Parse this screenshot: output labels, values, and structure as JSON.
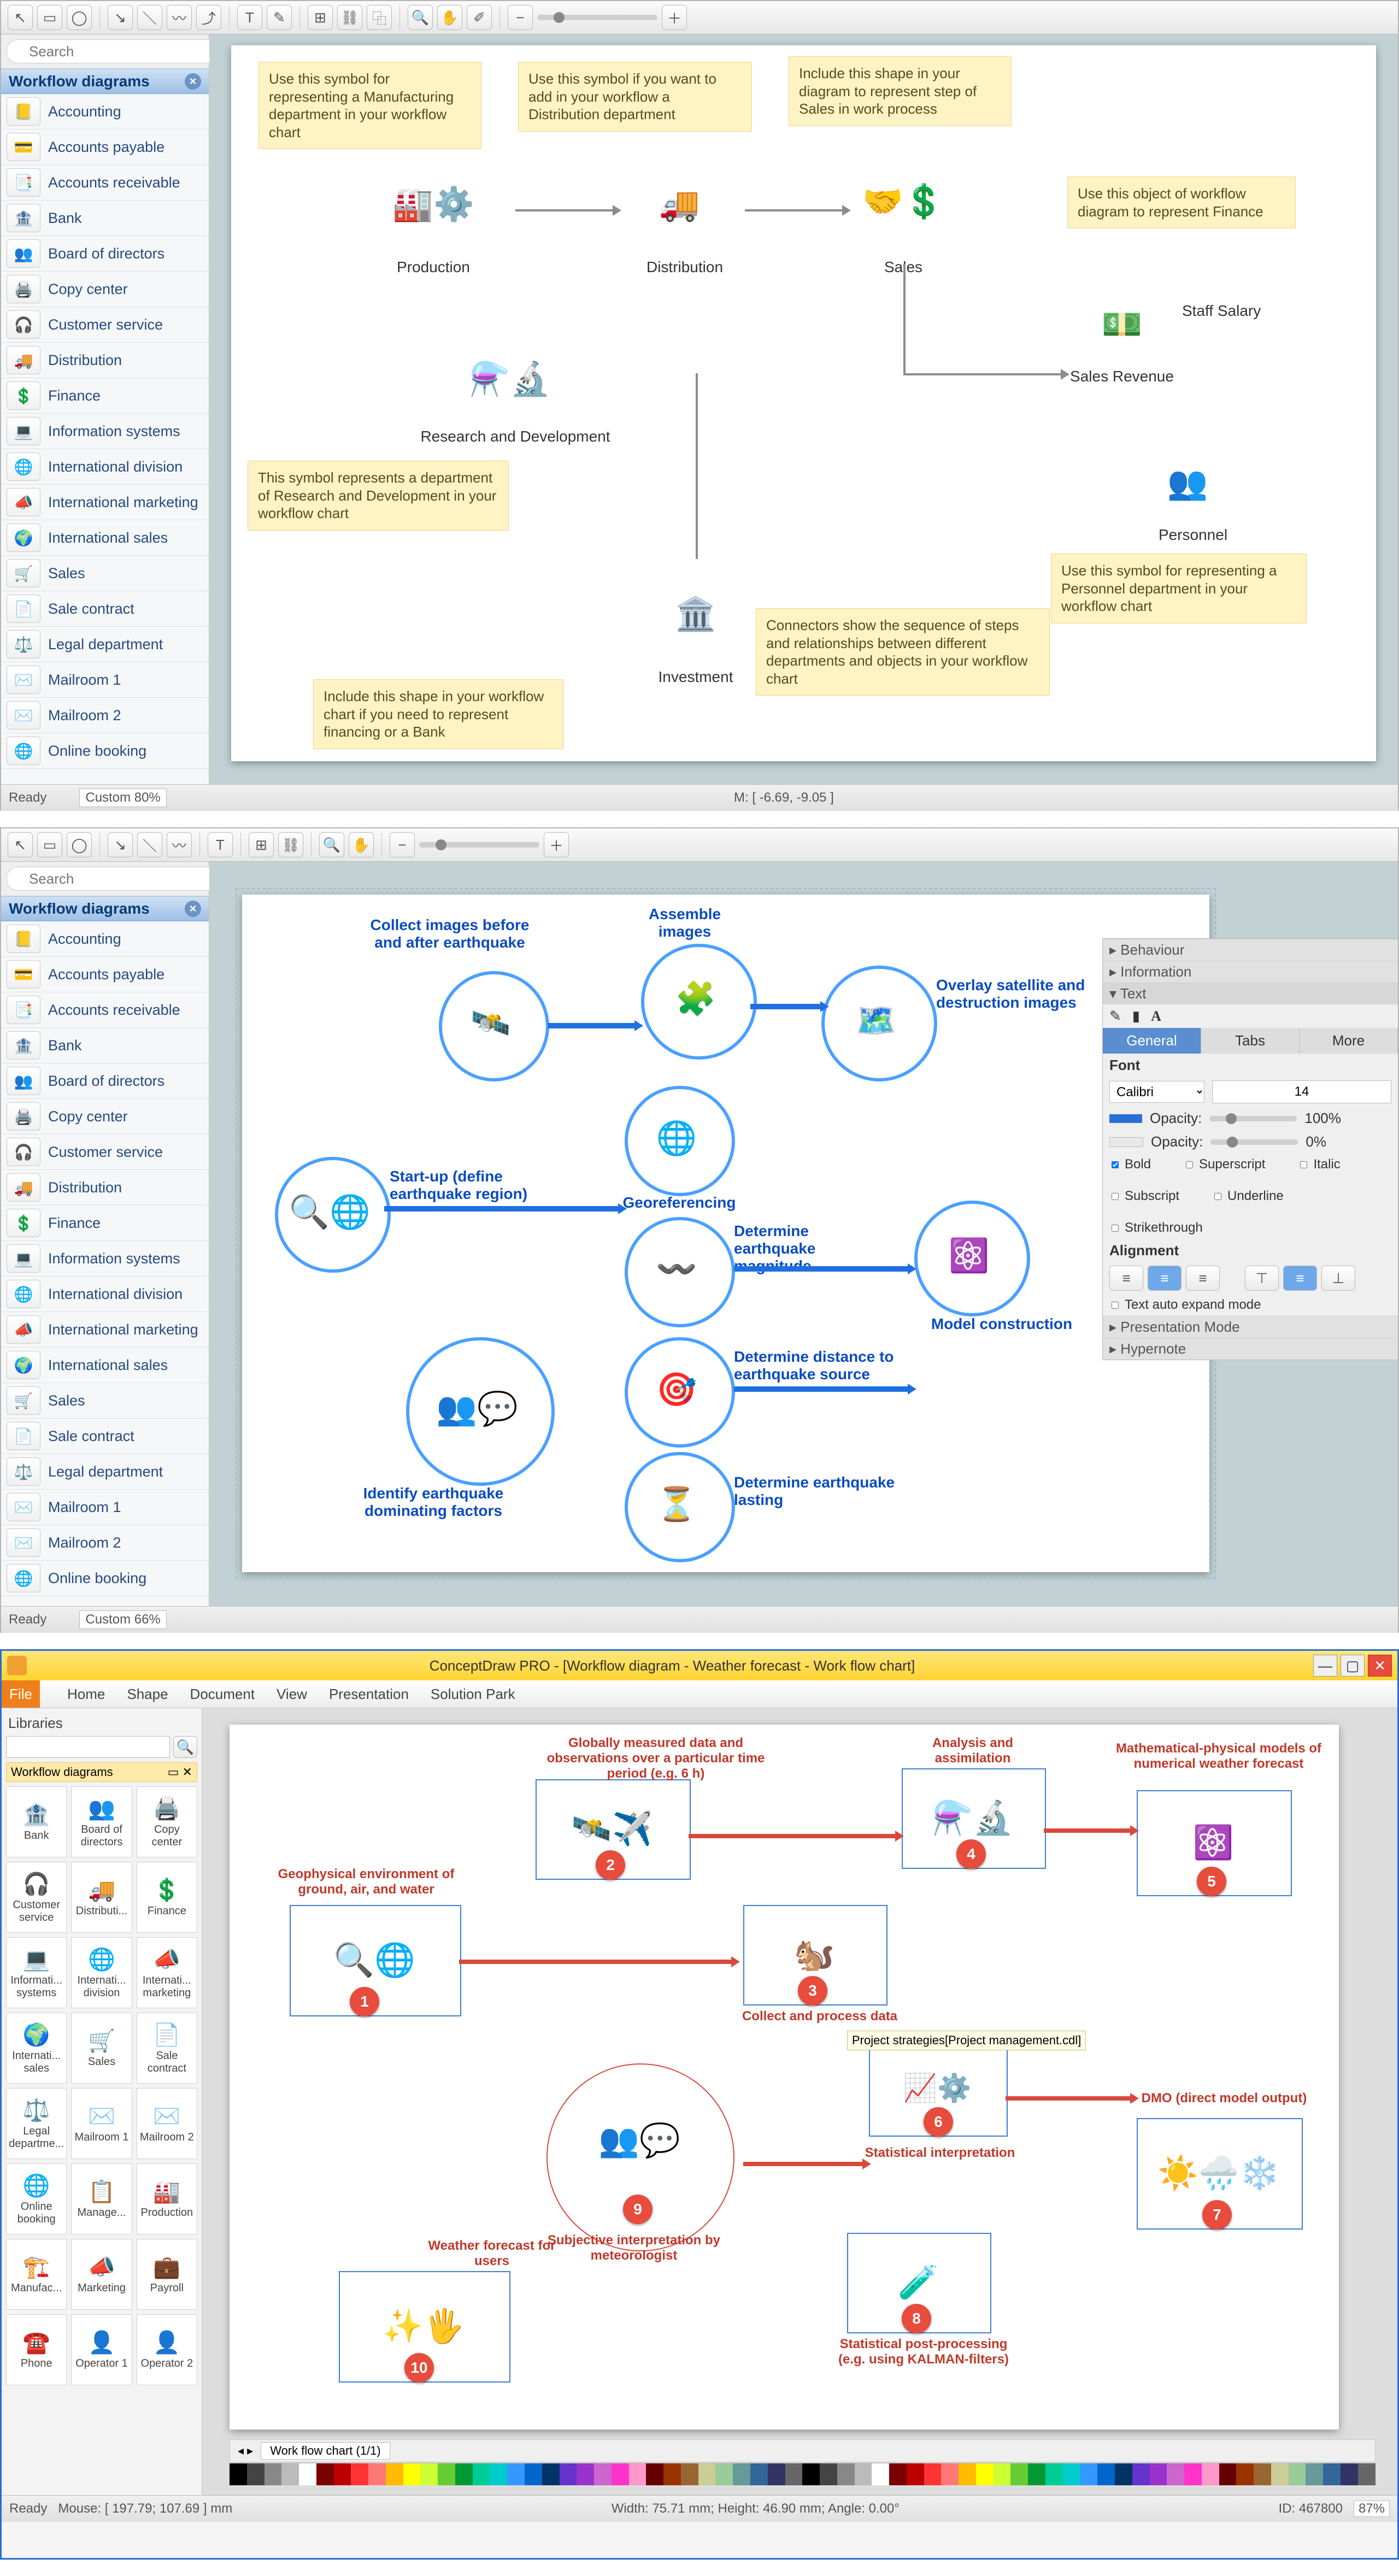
{
  "sidebar": {
    "title": "Workflow diagrams",
    "search_placeholder": "Search",
    "items": [
      "Accounting",
      "Accounts payable",
      "Accounts receivable",
      "Bank",
      "Board of directors",
      "Copy center",
      "Customer service",
      "Distribution",
      "Finance",
      "Information systems",
      "International division",
      "International marketing",
      "International sales",
      "Sales",
      "Sale contract",
      "Legal department",
      "Mailroom 1",
      "Mailroom 2",
      "Online booking"
    ]
  },
  "w1": {
    "zoom": "Custom 80%",
    "mouse": "M: [ -6.69, -9.05 ]",
    "status": "Ready",
    "labels": {
      "production": "Production",
      "distribution": "Distribution",
      "sales": "Sales",
      "staff_salary": "Staff Salary",
      "sales_revenue": "Sales Revenue",
      "rnd": "Research and Development",
      "personnel": "Personnel",
      "investment": "Investment"
    },
    "notes": {
      "n1": "Use this symbol for representing a Manufacturing department in your workflow chart",
      "n2": "Use this symbol if you want to add in your workflow a Distribution department",
      "n3": "Include this shape in your diagram to represent step of Sales in work process",
      "n4": "Use this object of workflow diagram to represent Finance",
      "n5": "This symbol represents a department of Research and Development in your workflow chart",
      "n6": "Use this symbol for representing a Personnel department in your workflow chart",
      "n7": "Include this shape in your workflow chart if you need to represent financing or a Bank",
      "n8": "Connectors show the sequence of steps and relationships between different departments and objects in your workflow chart"
    }
  },
  "w2": {
    "zoom": "Custom 66%",
    "status": "Ready",
    "nodes": {
      "startup": "Start-up (define earthquake region)",
      "collect": "Collect images before and after earthquake",
      "assemble": "Assemble images",
      "overlay": "Overlay satellite and destruction images",
      "georef": "Georeferencing",
      "magnitude": "Determine earthquake magnitude",
      "model": "Model construction",
      "distance": "Determine distance to earthquake source",
      "lasting": "Determine earthquake lasting",
      "identify": "Identify earthquake dominating factors"
    },
    "props": {
      "sect_behaviour": "Behaviour",
      "sect_information": "Information",
      "sect_text": "Text",
      "tab_general": "General",
      "tab_tabs": "Tabs",
      "tab_more": "More",
      "font_label": "Font",
      "font": "Calibri",
      "size": "14",
      "opacity_label": "Opacity:",
      "opacity1": "100%",
      "opacity2": "0%",
      "bold": "Bold",
      "italic": "Italic",
      "underline": "Underline",
      "strike": "Strikethrough",
      "superscript": "Superscript",
      "subscript": "Subscript",
      "alignment": "Alignment",
      "autoexp": "Text auto expand mode",
      "presentation": "Presentation Mode",
      "hypernote": "Hypernote"
    }
  },
  "w3": {
    "title": "ConceptDraw PRO - [Workflow diagram - Weather forecast - Work flow chart]",
    "menus": [
      "File",
      "Home",
      "Shape",
      "Document",
      "View",
      "Presentation",
      "Solution Park"
    ],
    "lib_title": "Libraries",
    "lib_group": "Workflow diagrams",
    "lib_items": [
      "Bank",
      "Board of directors",
      "Copy center",
      "Customer service",
      "Distributi...",
      "Finance",
      "Informati... systems",
      "Internati... division",
      "Internati... marketing",
      "Internati... sales",
      "Sales",
      "Sale contract",
      "Legal departme...",
      "Mailroom 1",
      "Mailroom 2",
      "Online booking",
      "Manage...",
      "Production",
      "Manufac...",
      "Marketing",
      "Payroll",
      "Phone",
      "Operator 1",
      "Operator 2"
    ],
    "tab": "Work flow chart (1/1)",
    "nodes": {
      "n1": "Geophysical environment of ground, air, and water",
      "n2": "Globally measured data and observations over a particular time period (e.g. 6 h)",
      "n3": "Collect and process data",
      "n4": "Analysis and assimilation",
      "n5": "Mathematical-physical models of numerical weather forecast",
      "tooltip": "Project strategies[Project management.cdl]",
      "stat": "Statistical interpretation",
      "n7": "DMO (direct model output)",
      "n8": "Statistical post-processing (e.g. using KALMAN-filters)",
      "n9": "Subjective interpretation by meteorologist",
      "n10": "Weather forecast for users"
    },
    "status": {
      "ready": "Ready",
      "mouse": "Mouse: [ 197.79; 107.69 ] mm",
      "size": "Width: 75.71 mm; Height: 46.90 mm; Angle: 0.00°",
      "id": "ID: 467800",
      "zoom": "87%"
    }
  }
}
